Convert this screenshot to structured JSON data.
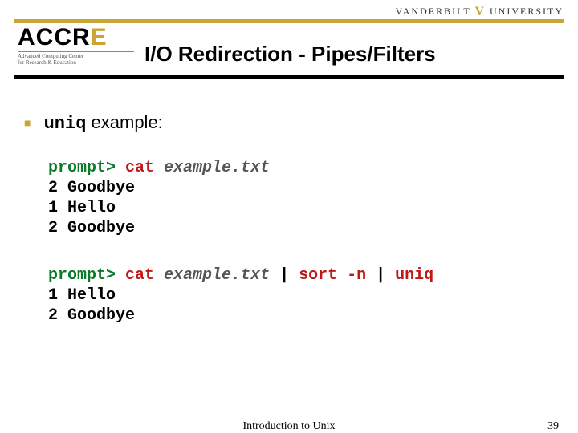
{
  "branding": {
    "vanderbilt_left": "VANDERBILT",
    "vanderbilt_right": "UNIVERSITY",
    "logo_text_pre": "ACCR",
    "logo_text_e": "E",
    "logo_sub1": "Advanced Computing Center",
    "logo_sub2": "for Research & Education"
  },
  "slide": {
    "title": "I/O Redirection - Pipes/Filters",
    "bullet_cmd": "uniq",
    "bullet_rest": " example:"
  },
  "code1": {
    "prompt": "prompt>",
    "cmd": " cat ",
    "arg": "example.txt",
    "out": "2 Goodbye\n1 Hello\n2 Goodbye"
  },
  "code2": {
    "prompt": "prompt>",
    "cmd1": " cat ",
    "arg": "example.txt",
    "pipe1": " | ",
    "cmd2": "sort -n",
    "pipe2": " | ",
    "cmd3": "uniq",
    "out": "1 Hello\n2 Goodbye"
  },
  "footer": {
    "title": "Introduction to Unix",
    "page": "39"
  }
}
